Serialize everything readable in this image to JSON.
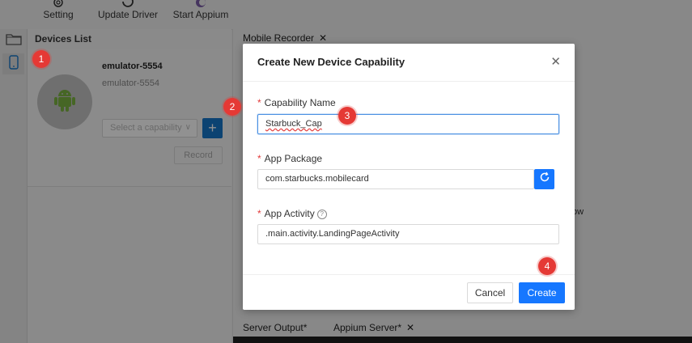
{
  "toolbar": {
    "items": [
      {
        "label": "Setting",
        "icon": "gear-icon"
      },
      {
        "label": "Update Driver",
        "icon": "refresh-icon"
      },
      {
        "label": "Start Appium",
        "icon": "appium-logo-icon"
      }
    ]
  },
  "rail": {
    "items": [
      {
        "icon": "folder-icon"
      },
      {
        "icon": "phone-icon",
        "active": true
      }
    ]
  },
  "devices": {
    "title": "Devices List",
    "device": {
      "name": "emulator-5554",
      "id": "emulator-5554",
      "icon": "android-icon"
    },
    "capability_placeholder": "Select a capability",
    "add_label": "+",
    "record_label": "Record"
  },
  "right": {
    "top_tab": "Mobile Recorder",
    "fragment_text": "ow",
    "bottom_tabs": [
      "Server Output*",
      "Appium Server*"
    ]
  },
  "modal": {
    "title": "Create New Device Capability",
    "required_mark": "*",
    "fields": {
      "capability_name": {
        "label": "Capability Name",
        "value": "Starbuck_Cap"
      },
      "app_package": {
        "label": "App Package",
        "value": "com.starbucks.mobilecard"
      },
      "app_activity": {
        "label": "App Activity",
        "value": ".main.activity.LandingPageActivity",
        "help": "?"
      }
    },
    "cancel_label": "Cancel",
    "create_label": "Create"
  },
  "badges": [
    "1",
    "2",
    "3",
    "4"
  ],
  "colors": {
    "primary": "#1677ff",
    "badge": "#e53935",
    "required": "#e23a3a"
  }
}
